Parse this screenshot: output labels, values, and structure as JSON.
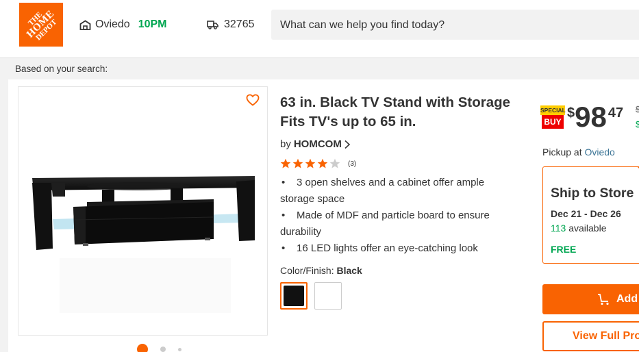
{
  "header": {
    "logo_text": "THE HOME DEPOT",
    "store_name": "Oviedo",
    "store_hours": "10PM",
    "zip": "32765",
    "search_placeholder": "What can we help you find today?"
  },
  "based_on": "Based on your search:",
  "product": {
    "title": "63 in. Black TV Stand with Storage Fits TV's up to 65 in.",
    "by_label": "by",
    "brand": "HOMCOM",
    "rating": 4.5,
    "review_count": "(3)",
    "bullets": [
      "3 open shelves and a cabinet offer ample storage space",
      "Made of MDF and particle board to ensure durability",
      "16 LED lights offer an eye-catching look"
    ],
    "color_label": "Color/Finish:",
    "color_value": "Black",
    "image_carousel": {
      "total": 3,
      "active": 0
    }
  },
  "pricing": {
    "badge_top": "SPECIAL",
    "badge_bottom": "BUY",
    "currency": "$",
    "dollars": "98",
    "cents": "47",
    "strike_fragment": "$",
    "save_fragment": "$"
  },
  "fulfillment": {
    "pickup_label": "Pickup at",
    "pickup_store": "Oviedo",
    "ship_title": "Ship to Store",
    "ship_dates": "Dec 21 - Dec 26",
    "available_count": "113",
    "available_label": "available",
    "shipping_cost": "FREE"
  },
  "actions": {
    "add_label": "Add t",
    "view_label": "View Full Pro"
  },
  "colors": {
    "brand_orange": "#f96302",
    "green": "#00a651",
    "link_blue": "#3e7697"
  }
}
